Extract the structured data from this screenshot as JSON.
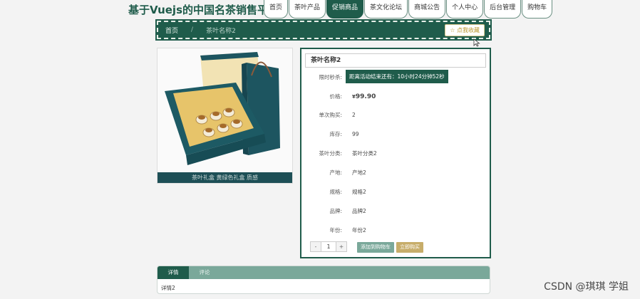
{
  "header": {
    "title": "基于Vuejs的中国名茶销售平台",
    "nav": [
      "首页",
      "茶叶产品",
      "促销商品",
      "茶文化论坛",
      "商城公告",
      "个人中心",
      "后台管理",
      "购物车"
    ],
    "active_nav": 2
  },
  "breadcrumb": {
    "home": "首页",
    "separator": "/",
    "current": "茶叶名称2",
    "favorite_label": "☆ 点我收藏"
  },
  "product": {
    "image_caption": "茶叶礼盒 黄绿色礼盒 质感",
    "name": "茶叶名称2",
    "flash_label": "限时秒杀:",
    "countdown": "距离活动结束还有：10小时24分钟52秒",
    "price_label": "价格:",
    "price_symbol": "¥",
    "price": "99.90",
    "fields": [
      {
        "label": "单次购买:",
        "value": "2"
      },
      {
        "label": "库存:",
        "value": "99"
      },
      {
        "label": "茶叶分类:",
        "value": "茶叶分类2"
      },
      {
        "label": "产地:",
        "value": "产地2"
      },
      {
        "label": "规格:",
        "value": "规格2"
      },
      {
        "label": "品牌:",
        "value": "品牌2"
      },
      {
        "label": "年份:",
        "value": "年份2"
      }
    ],
    "qty_minus": "-",
    "qty_value": "1",
    "qty_plus": "+",
    "add_cart_label": "添加到购物车",
    "buy_label": "立即购买"
  },
  "tabs": {
    "items": [
      "详情",
      "评论"
    ],
    "active": 0,
    "content": "详情2"
  },
  "watermark": "CSDN @琪琪 学姐",
  "colors": {
    "primary": "#1f5c4b",
    "tab_bar": "#7aa89a",
    "price": "#c0392b",
    "buy": "#c7ad6a"
  }
}
